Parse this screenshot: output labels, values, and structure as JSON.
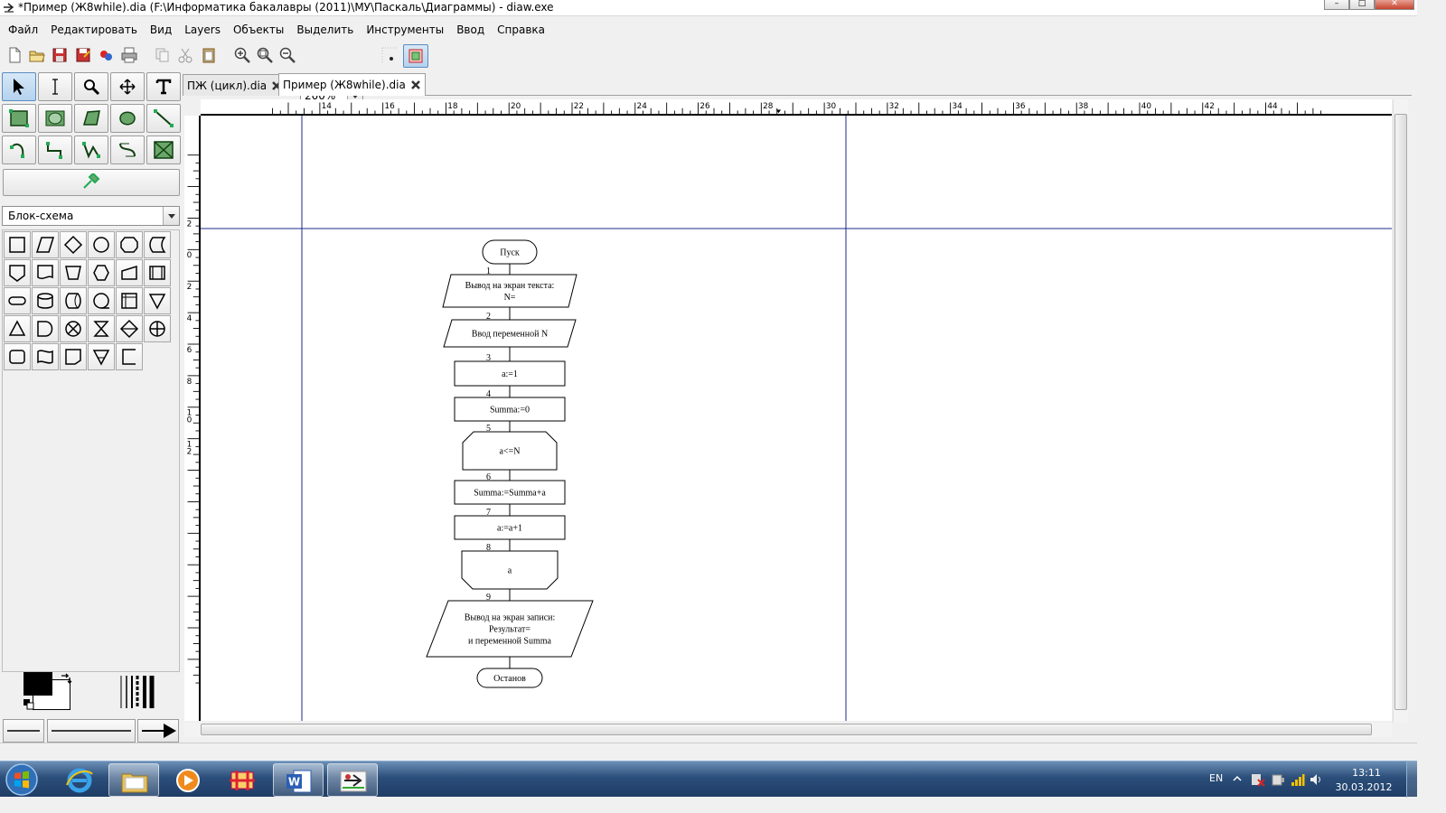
{
  "window": {
    "title": "*Пример (Ж8while).dia (F:\\Информатика бакалавры (2011)\\МУ\\Паскаль\\Диаграммы) - diaw.exe"
  },
  "menu": [
    "Файл",
    "Редактировать",
    "Вид",
    "Layers",
    "Объекты",
    "Выделить",
    "Инструменты",
    "Ввод",
    "Справка"
  ],
  "toolbar": {
    "zoom_value": "200%",
    "icons": [
      "new-file-icon",
      "open-folder-icon",
      "save-icon",
      "save-as-icon",
      "export-icon",
      "print-icon",
      "copy-icon",
      "cut-icon",
      "paste-icon",
      "zoom-in-icon",
      "zoom-fit-icon",
      "zoom-out-icon",
      "snap-grid-icon",
      "snap-object-icon"
    ]
  },
  "toolbox": {
    "sheet_selected": "Блок-схема",
    "tools": [
      "pointer-icon",
      "text-cursor-icon",
      "magnify-icon",
      "move-icon",
      "text-tool-icon",
      "box-tool-icon",
      "ellipse-tool-icon",
      "polygon-tool-icon",
      "beziergon-tool-icon",
      "line-tool-icon",
      "arc-tool-icon",
      "zigzag-line-icon",
      "polyline-icon",
      "bezier-line-icon",
      "image-tool-icon"
    ],
    "misc_tool": "outline-tool-icon"
  },
  "tabs": [
    {
      "label": "ПЖ (цикл).dia",
      "active": false
    },
    {
      "label": "Пример (Ж8while).dia",
      "active": true
    }
  ],
  "ruler": {
    "h_labels": [
      "14",
      "16",
      "18",
      "20",
      "22",
      "24",
      "26",
      "28",
      "30",
      "32",
      "34",
      "36",
      "38",
      "40",
      "42",
      "44"
    ],
    "v_labels": [
      "2",
      "0",
      "2",
      "4",
      "6",
      "8",
      "1\n0",
      "1\n2"
    ]
  },
  "flowchart": {
    "nodes": [
      {
        "id": "start",
        "shape": "terminal",
        "text": [
          "Пуск"
        ]
      },
      {
        "id": "n1",
        "shape": "parallelogram",
        "text": [
          "Вывод на экран текста:",
          "N="
        ],
        "number": "1"
      },
      {
        "id": "n2",
        "shape": "parallelogram",
        "text": [
          "Ввод переменной N"
        ],
        "number": "2"
      },
      {
        "id": "n3",
        "shape": "rect",
        "text": [
          "a:=1"
        ],
        "number": "3"
      },
      {
        "id": "n4",
        "shape": "rect",
        "text": [
          "Summa:=0"
        ],
        "number": "4"
      },
      {
        "id": "n5",
        "shape": "loop-start",
        "text": [
          "a<=N"
        ],
        "number": "5"
      },
      {
        "id": "n6",
        "shape": "rect",
        "text": [
          "Summa:=Summa+a"
        ],
        "number": "6"
      },
      {
        "id": "n7",
        "shape": "rect",
        "text": [
          "a:=a+1"
        ],
        "number": "7"
      },
      {
        "id": "n8",
        "shape": "loop-end",
        "text": [
          "a"
        ],
        "number": "8"
      },
      {
        "id": "n9",
        "shape": "parallelogram",
        "text": [
          "Вывод  на  экран записи:",
          "Результат=",
          "и переменной Summa"
        ],
        "number": "9"
      },
      {
        "id": "end",
        "shape": "terminal",
        "text": [
          "Останов"
        ]
      }
    ]
  },
  "colors": {
    "guide_line": "#1c2a8a",
    "selected_tool": "#b4d2ee"
  },
  "taskbar": {
    "apps": [
      "windows-start-icon",
      "internet-explorer-icon",
      "file-explorer-icon",
      "media-player-icon",
      "paint-app-icon",
      "word-icon",
      "dia-icon"
    ],
    "language": "EN",
    "time": "13:11",
    "date": "30.03.2012"
  }
}
